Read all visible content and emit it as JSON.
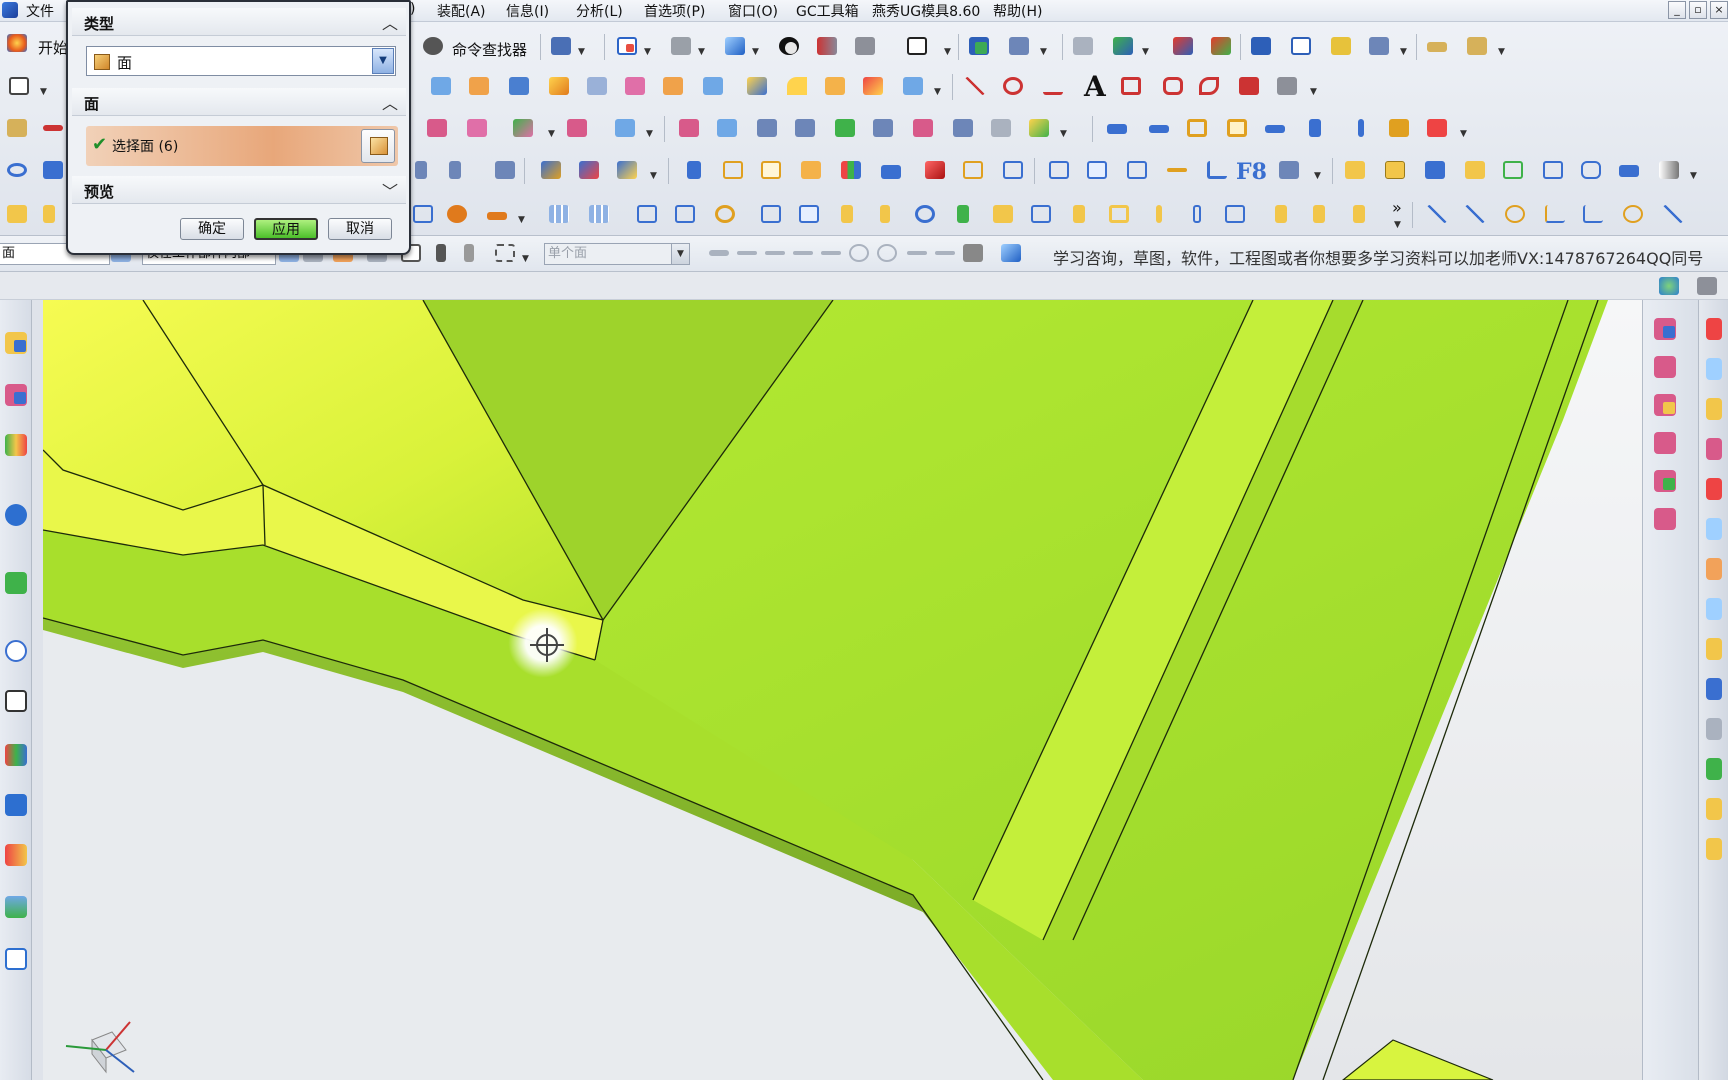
{
  "menubar": {
    "items": [
      "文件(F)",
      "装配(A)",
      "信息(I)",
      "分析(L)",
      "首选项(P)",
      "窗口(O)",
      "GC工具箱",
      "燕秀UG模具8.60",
      "帮助(H)"
    ],
    "visible_fragments": {
      "file": "文件",
      "paren": ")"
    }
  },
  "toolbar": {
    "start_label": "开始",
    "command_finder_label": "命令查找器",
    "text_glyph": "A",
    "f8_glyph": "F8",
    "more_glyph": "»"
  },
  "selection_bar": {
    "filter_value": "面",
    "scope_value": "仅在工作部件内部",
    "face_rule_value": "单个面",
    "notice": "学习咨询，草图，软件，工程图或者你想要多学习资料可以加老师VX:1478767264QQ同号"
  },
  "dialog": {
    "type_group_title": "类型",
    "type_value": "面",
    "face_group_title": "面",
    "select_face_label": "选择面 (6)",
    "preview_group_title": "预览",
    "ok_label": "确定",
    "apply_label": "应用",
    "cancel_label": "取消"
  },
  "colors": {
    "model_face_main": "#a6e22e",
    "model_face_light": "#d7f542",
    "model_face_dark": "#7fb51f",
    "apply_button": "#4cbf2a",
    "selection_highlight": "#e8a77a"
  },
  "icons": [
    "app-icon",
    "start-icon",
    "command-finder-icon",
    "cube-icon",
    "check-icon",
    "selection-cursor-icon",
    "csys-triad-icon",
    "chevron-up-icon",
    "chevron-down-icon"
  ]
}
